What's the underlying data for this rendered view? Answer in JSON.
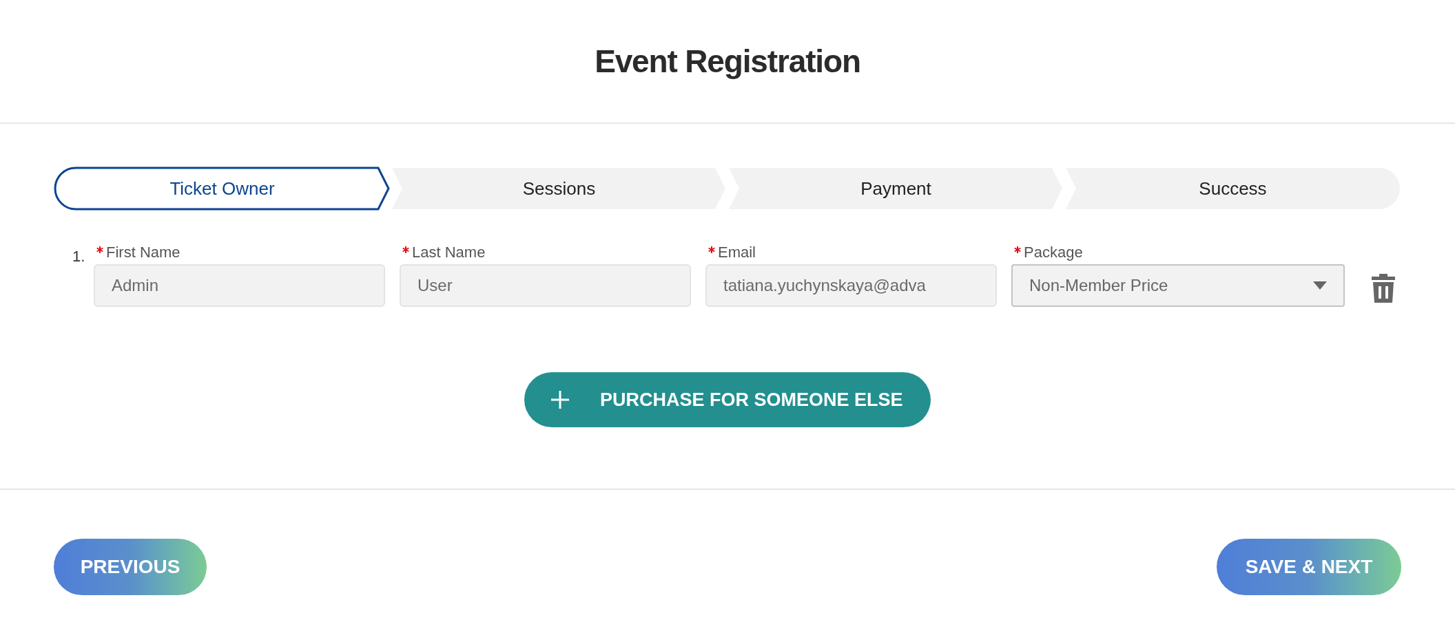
{
  "title": "Event Registration",
  "steps": [
    {
      "label": "Ticket Owner",
      "selected": true
    },
    {
      "label": "Sessions",
      "selected": false
    },
    {
      "label": "Payment",
      "selected": false
    },
    {
      "label": "Success",
      "selected": false
    }
  ],
  "attendees": [
    {
      "number": "1.",
      "fields": [
        {
          "kind": "text",
          "label": "First Name",
          "required": true,
          "value": "Admin"
        },
        {
          "kind": "text",
          "label": "Last Name",
          "required": true,
          "value": "User"
        },
        {
          "kind": "text",
          "label": "Email",
          "required": true,
          "value": "tatiana.yuchynskaya@adva"
        },
        {
          "kind": "select",
          "label": "Package",
          "required": true,
          "value": "Non-Member Price"
        }
      ]
    }
  ],
  "add_button": "PURCHASE FOR SOMEONE ELSE",
  "previous_button": "PREVIOUS",
  "next_button": "SAVE & NEXT"
}
